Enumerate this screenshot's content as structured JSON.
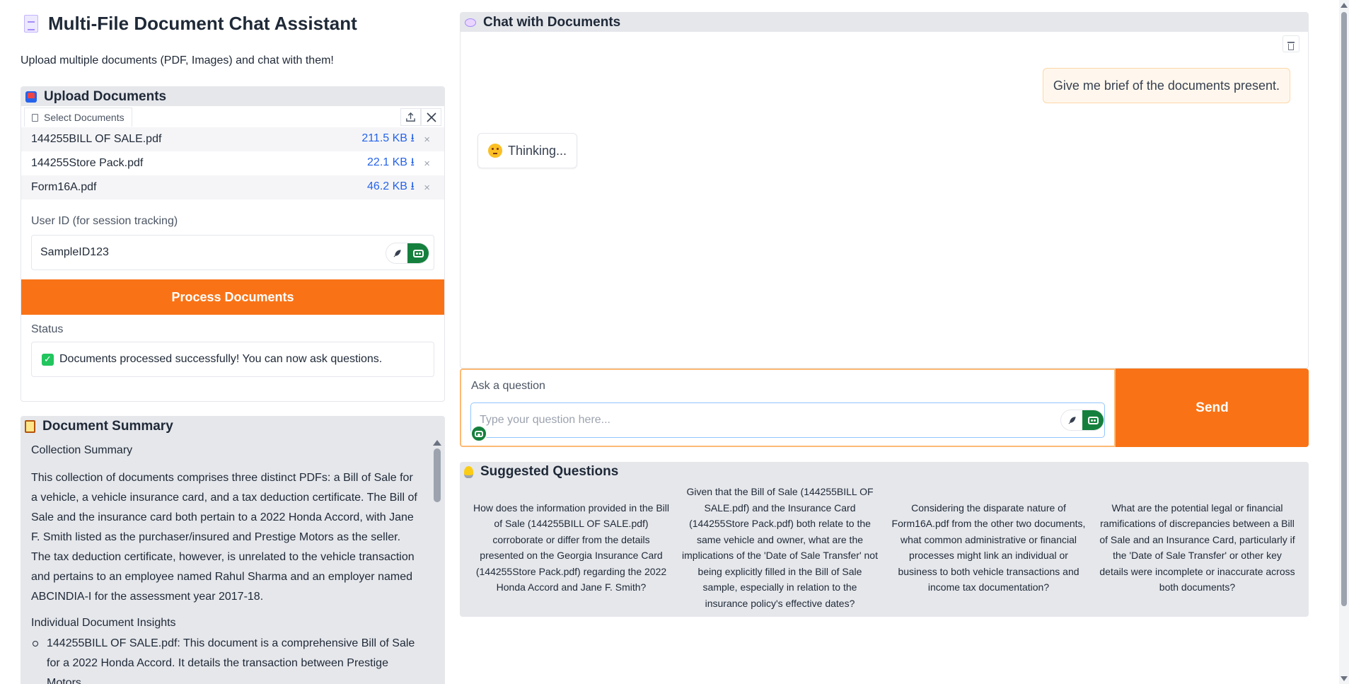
{
  "app": {
    "title": "Multi-File Document Chat Assistant",
    "subtitle": "Upload multiple documents (PDF, Images) and chat with them!"
  },
  "upload": {
    "header": "Upload Documents",
    "tab_label": "Select Documents",
    "files": [
      {
        "name": "144255BILL OF SALE.pdf",
        "size": "211.5 KB ⭳",
        "remove": "×"
      },
      {
        "name": "144255Store Pack.pdf",
        "size": "22.1 KB ⭳",
        "remove": "×"
      },
      {
        "name": "Form16A.pdf",
        "size": "46.2 KB ⭳",
        "remove": "×"
      }
    ],
    "user_id_label": "User ID (for session tracking)",
    "user_id_value": "SampleID123",
    "process_label": "Process Documents",
    "status_label": "Status",
    "status_check": "✓",
    "status_text": "Documents processed successfully! You can now ask questions."
  },
  "summary": {
    "header": "Document Summary",
    "collection_heading": "Collection Summary",
    "collection_text": "This collection of documents comprises three distinct PDFs: a Bill of Sale for a vehicle, a vehicle insurance card, and a tax deduction certificate. The Bill of Sale and the insurance card both pertain to a 2022 Honda Accord, with Jane F. Smith listed as the purchaser/insured and Prestige Motors as the seller. The tax deduction certificate, however, is unrelated to the vehicle transaction and pertains to an employee named Rahul Sharma and an employer named ABCINDIA-I for the assessment year 2017-18.",
    "insights_heading": "Individual Document Insights",
    "insight_1": "144255BILL OF SALE.pdf: This document is a comprehensive Bill of Sale for a 2022 Honda Accord. It details the transaction between Prestige Motors"
  },
  "chat": {
    "header": "Chat with Documents",
    "user_message": "Give me brief of the documents present.",
    "bot_message": "Thinking...",
    "ask_label": "Ask a question",
    "ask_placeholder": "Type your question here...",
    "send_label": "Send"
  },
  "suggested": {
    "header": "Suggested Questions",
    "questions": [
      "How does the information provided in the Bill of Sale (144255BILL OF SALE.pdf) corroborate or differ from the details presented on the Georgia Insurance Card (144255Store Pack.pdf) regarding the 2022 Honda Accord and Jane F. Smith?",
      "Given that the Bill of Sale (144255BILL OF SALE.pdf) and the Insurance Card (144255Store Pack.pdf) both relate to the same vehicle and owner, what are the implications of the 'Date of Sale Transfer' not being explicitly filled in the Bill of Sale sample, especially in relation to the insurance policy's effective dates?",
      "Considering the disparate nature of Form16A.pdf from the other two documents, what common administrative or financial processes might link an individual or business to both vehicle transactions and income tax documentation?",
      "What are the potential legal or financial ramifications of discrepancies between a Bill of Sale and an Insurance Card, particularly if the 'Date of Sale Transfer' or other key details were incomplete or inaccurate across both documents?"
    ]
  },
  "colors": {
    "accent": "#f97316",
    "link": "#2563eb",
    "success": "#22c55e",
    "panel": "#e5e7eb"
  },
  "icons": [
    "document-icon",
    "inbox-icon",
    "upload-icon",
    "close-icon",
    "feather-icon",
    "bot-icon",
    "check-icon",
    "clipboard-icon",
    "speech-bubble-icon",
    "trash-icon",
    "thinking-face-icon",
    "lightbulb-icon"
  ]
}
